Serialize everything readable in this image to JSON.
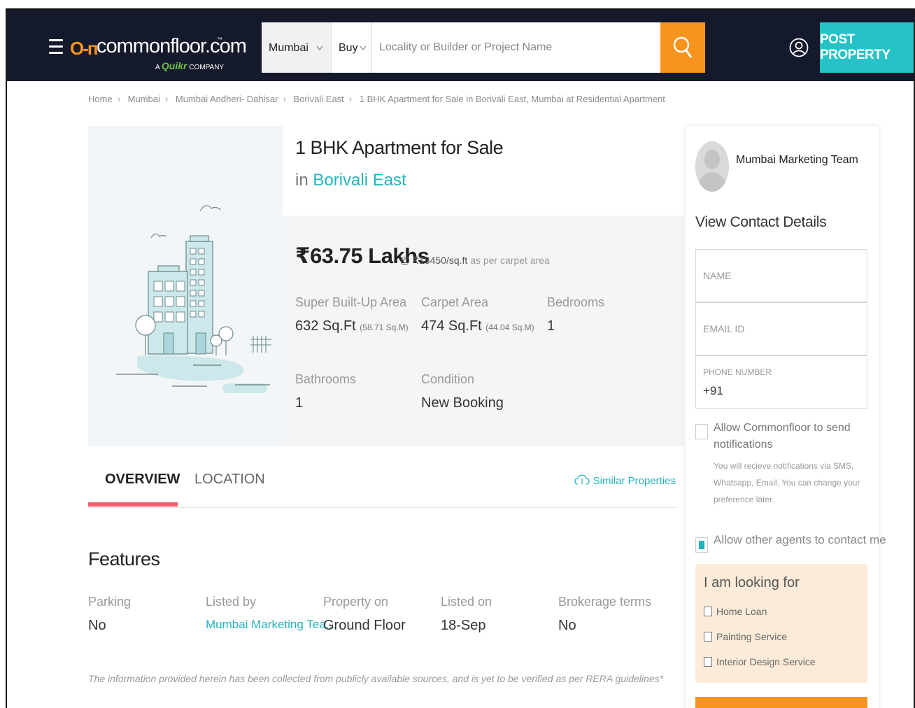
{
  "header": {
    "logo_text": "commonfloor.com",
    "logo_tm": "™",
    "logo_sub_prefix": "A",
    "logo_sub_brand": "Quikr",
    "logo_sub_suffix": "COMPANY",
    "city": "Mumbai",
    "type": "Buy",
    "search_placeholder": "Locality or Builder or Project Name",
    "post_button": "POST PROPERTY",
    "colors": {
      "bg": "#141a2b",
      "search_btn": "#f7941d",
      "post_btn": "#26c2c8"
    }
  },
  "breadcrumb": [
    "Home",
    "Mumbai",
    "Mumbai Andheri- Dahisar",
    "Borivali East",
    "1 BHK Apartment for Sale in Borivali East, Mumbai at Residential Apartment"
  ],
  "listing": {
    "title": "1 BHK Apartment for Sale",
    "in_prefix": "in",
    "locality": "Borivali East",
    "price": "₹63.75 Lakhs",
    "rate": "@ ₹13450/sq.ft",
    "rate_note": "as per carpet area",
    "specs": {
      "super_label": "Super Built-Up Area",
      "super_value": "632 Sq.Ft",
      "super_sub": "(58.71 Sq.M)",
      "carpet_label": "Carpet Area",
      "carpet_value": "474 Sq.Ft",
      "carpet_sub": "(44.04 Sq.M)",
      "bedrooms_label": "Bedrooms",
      "bedrooms_value": "1",
      "bathrooms_label": "Bathrooms",
      "bathrooms_value": "1",
      "condition_label": "Condition",
      "condition_value": "New Booking"
    }
  },
  "tabs": {
    "overview": "OVERVIEW",
    "location": "LOCATION",
    "similar": "Similar Properties"
  },
  "features": {
    "title": "Features",
    "items": [
      {
        "label": "Parking",
        "value": "No"
      },
      {
        "label": "Listed by",
        "value": "Mumbai Marketing Tea..."
      },
      {
        "label": "Property on",
        "value": "Ground Floor"
      },
      {
        "label": "Listed on",
        "value": "18-Sep"
      },
      {
        "label": "Brokerage terms",
        "value": "No"
      }
    ],
    "disclaimer": "The information provided herein has been collected from publicly available sources, and is yet to be verified as per RERA guidelines*"
  },
  "sidebar": {
    "agent_name": "Mumbai Marketing Team",
    "contact_title": "View Contact Details",
    "name_placeholder": "NAME",
    "email_placeholder": "EMAIL ID",
    "phone_label": "PHONE NUMBER",
    "phone_prefix": "+91",
    "notify_text": "Allow Commonfloor to send notifications",
    "notify_sub": "You will recieve notifications via SMS, Whatsapp, Email. You can change your preference later.",
    "notify_checked": false,
    "agents_text": "Allow other agents to contact me",
    "agents_checked": true,
    "looking_title": "I am looking for",
    "looking_options": [
      "Home Loan",
      "Painting Service",
      "Interior Design Service"
    ]
  }
}
